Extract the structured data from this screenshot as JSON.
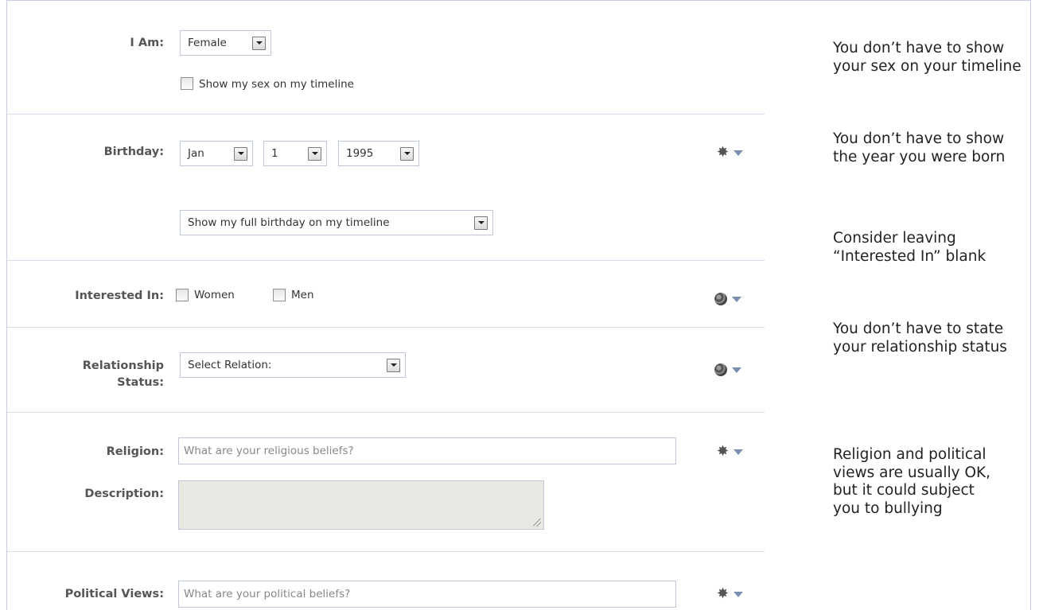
{
  "form": {
    "i_am": {
      "label": "I Am:",
      "value": "Female",
      "show_sex_label": "Show my sex on my timeline"
    },
    "birthday": {
      "label": "Birthday:",
      "month": "Jan",
      "day": "1",
      "year": "1995",
      "visibility": "Show my full birthday on my timeline"
    },
    "interested_in": {
      "label": "Interested In:",
      "women": "Women",
      "men": "Men"
    },
    "relationship": {
      "label_line1": "Relationship",
      "label_line2": "Status:",
      "value": "Select Relation:"
    },
    "religion": {
      "label": "Religion:",
      "placeholder": "What are your religious beliefs?"
    },
    "description": {
      "label": "Description:"
    },
    "political": {
      "label": "Political Views:",
      "placeholder": "What are your political beliefs?"
    }
  },
  "tips": {
    "sex": "You don’t have to show your sex on your timeline",
    "birthday": "You don’t have to show the year you were born",
    "interested": "Consider leaving “Interested In” blank",
    "relationship": "You don’t have to state your relationship status",
    "religion": "Religion and political views are usually OK, but it could subject you to bullying"
  },
  "icons": {
    "gear": "gear-icon",
    "globe": "globe-icon",
    "caret": "caret-down-icon"
  },
  "colors": {
    "border": "#bdc7d8",
    "divider": "#d8dfea",
    "caret": "#7a8db3",
    "textarea_bg": "#e9e9e3"
  }
}
